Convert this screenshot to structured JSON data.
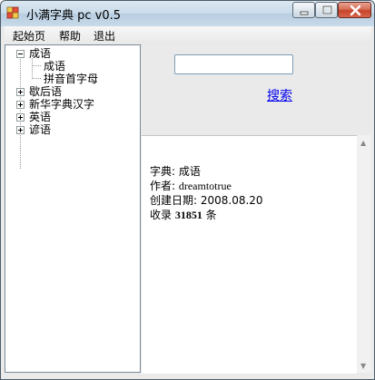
{
  "window": {
    "title": "小满字典 pc v0.5"
  },
  "menu": [
    {
      "label": "起始页"
    },
    {
      "label": "帮助"
    },
    {
      "label": "退出"
    }
  ],
  "tree": {
    "items": [
      {
        "label": "成语",
        "state": "expanded",
        "children": [
          {
            "label": "成语"
          },
          {
            "label": "拼音首字母"
          }
        ]
      },
      {
        "label": "歇后语",
        "state": "collapsed"
      },
      {
        "label": "新华字典汉字",
        "state": "collapsed"
      },
      {
        "label": "英语",
        "state": "collapsed"
      },
      {
        "label": "谚语",
        "state": "collapsed"
      }
    ]
  },
  "search": {
    "value": "",
    "button_label": "搜索"
  },
  "info": {
    "dict_label": "字典: ",
    "dict_value": "成语",
    "author_label": "作者: ",
    "author_value": "dreamtotrue",
    "date_label": "创建日期: ",
    "date_value": "2008.08.20",
    "count_label": "收录 ",
    "count_value": "31851",
    "count_unit": " 条"
  },
  "colors": {
    "link": "#0000ee",
    "close_button": "#c5432a"
  }
}
